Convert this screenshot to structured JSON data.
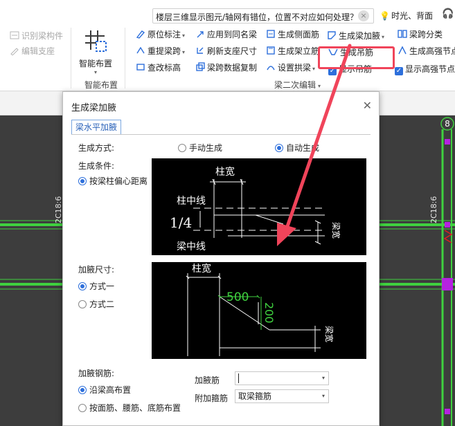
{
  "search": {
    "query": "楼层三维显示图元/轴网有错位，位置不对应如何处理？"
  },
  "user": {
    "name": "时光、背面"
  },
  "ribbon": {
    "left_items": [
      "识别梁构件",
      "编辑支座"
    ],
    "big_button": "智能布置",
    "group_smart": "智能布置",
    "group_beam2": "梁二次编辑",
    "col1": [
      "原位标注",
      "重提梁跨",
      "查改标高"
    ],
    "col2": [
      "应用到同名梁",
      "刷新支座尺寸",
      "梁跨数据复制"
    ],
    "col3": [
      "生成侧面筋",
      "生成架立筋",
      "设置拱梁"
    ],
    "col4": [
      "生成梁加腋",
      "生成吊筋",
      "显示吊筋"
    ],
    "col5": [
      "梁跨分类",
      "生成高强节点",
      "显示高强节点"
    ]
  },
  "canvas": {
    "left_label": "2C18:6",
    "right_label": "2C18:6",
    "axis_number": "8"
  },
  "dialog": {
    "title": "生成梁加腋",
    "tab": "梁水平加腋",
    "method_label": "生成方式:",
    "method_manual": "手动生成",
    "method_auto": "自动生成",
    "condition_label": "生成条件:",
    "condition_opt": "按梁柱偏心距离",
    "size_label": "加腋尺寸:",
    "size_opt1": "方式一",
    "size_opt2": "方式二",
    "rebar_label": "加腋钢筋:",
    "rebar_opt1": "沿梁高布置",
    "rebar_opt2": "按面筋、腰筋、底筋布置",
    "haunch_rebar_label": "加腋筋",
    "haunch_rebar_value": "",
    "stirrup_label": "附加箍筋",
    "stirrup_value": "取梁箍筋",
    "diagram1": {
      "col_width": "柱宽",
      "col_center": "柱中线",
      "ratio": "1/4",
      "beam_center": "梁中线",
      "beam_width": "梁宽"
    },
    "diagram2": {
      "col_width": "柱宽",
      "len": "500",
      "width": "200",
      "beam_width": "梁宽"
    }
  },
  "colors": {
    "highlight": "#f0445a",
    "arrow": "#f0445a",
    "accent": "#2d6fdb",
    "beam_green": "#3fd13f",
    "canvas": "#3d3d3d"
  }
}
